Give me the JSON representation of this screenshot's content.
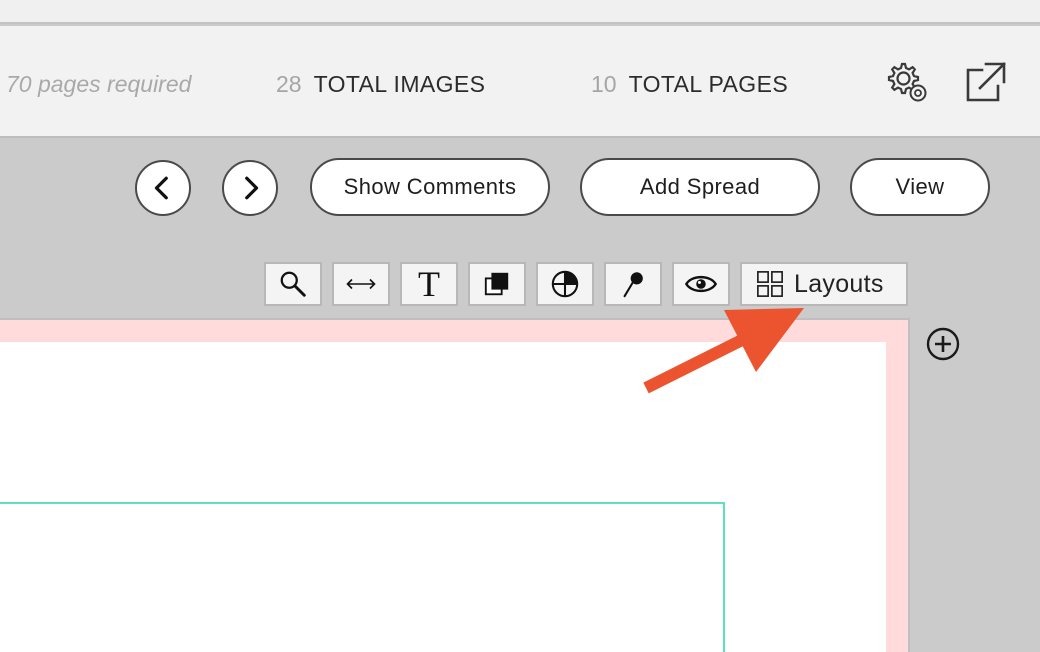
{
  "header": {
    "pages_required": "70 pages required",
    "total_images_count": "28",
    "total_images_label": "TOTAL IMAGES",
    "total_pages_count": "10",
    "total_pages_label": "TOTAL PAGES",
    "settings_icon": "gear-icon",
    "export_icon": "external-link-icon"
  },
  "toolbar": {
    "prev_icon": "chevron-left-icon",
    "next_icon": "chevron-right-icon",
    "show_comments_label": "Show Comments",
    "add_spread_label": "Add Spread",
    "view_label": "View"
  },
  "tools": {
    "items": [
      {
        "name": "zoom-tool",
        "icon": "magnifier-icon"
      },
      {
        "name": "stretch-tool",
        "icon": "double-arrow-icon"
      },
      {
        "name": "text-tool",
        "icon": "text-icon",
        "glyph": "T"
      },
      {
        "name": "arrange-tool",
        "icon": "layers-icon"
      },
      {
        "name": "crop-tool",
        "icon": "pie-icon"
      },
      {
        "name": "pin-tool",
        "icon": "pin-icon"
      },
      {
        "name": "preview-tool",
        "icon": "eye-icon"
      }
    ],
    "layouts_label": "Layouts",
    "layouts_icon": "grid-icon"
  },
  "canvas": {
    "add_page_icon": "plus-circle-icon",
    "annotation_color": "#ec532f",
    "frame_color": "#5ce0bf",
    "bleed_color": "#ffdcdb"
  }
}
